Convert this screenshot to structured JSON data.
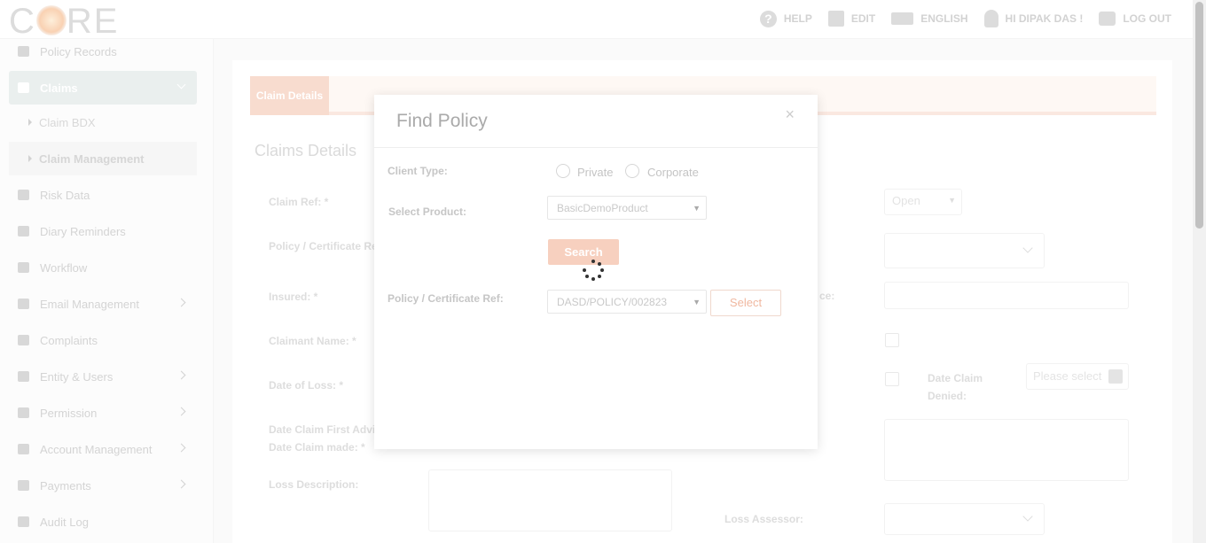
{
  "topbar": {
    "logo_text": "C RE",
    "nav": [
      {
        "label": "HELP",
        "icon": "help-icon"
      },
      {
        "label": "EDIT",
        "icon": "edit-icon"
      },
      {
        "label": "ENGLISH",
        "icon": "language-icon"
      },
      {
        "label": "HI DIPAK DAS !",
        "icon": "user-icon"
      },
      {
        "label": "LOG OUT",
        "icon": "logout-icon"
      }
    ]
  },
  "sidebar": {
    "items": [
      {
        "label": "Policy Records",
        "icon": "records-icon"
      },
      {
        "label": "Claims",
        "icon": "user-icon"
      },
      {
        "label": "Claim BDX"
      },
      {
        "label": "Claim Management"
      },
      {
        "label": "Risk Data",
        "icon": "scale-icon"
      },
      {
        "label": "Diary Reminders",
        "icon": "calendar-icon"
      },
      {
        "label": "Workflow",
        "icon": "sitemap-icon"
      },
      {
        "label": "Email Management",
        "icon": "at-icon"
      },
      {
        "label": "Complaints",
        "icon": "warning-icon"
      },
      {
        "label": "Entity & Users",
        "icon": "user-icon"
      },
      {
        "label": "Permission",
        "icon": "key-icon"
      },
      {
        "label": "Account Management",
        "icon": "card-icon"
      },
      {
        "label": "Payments",
        "icon": "card-icon"
      },
      {
        "label": "Audit Log",
        "icon": "chart-icon"
      }
    ]
  },
  "main": {
    "tab_label": "Claim Details",
    "section_title": "Claims Details",
    "labels": {
      "claim_ref": "Claim Ref: *",
      "policy_ref": "Policy / Certificate Re",
      "insured": "Insured: *",
      "claimant": "Claimant Name: *",
      "date_of_loss": "Date of Loss: *",
      "date_first_advice": "Date Claim First Advi",
      "date_claim_made": "Date Claim made: *",
      "loss_description": "Loss Description:",
      "ice": "ce:",
      "date_claim_denied": "Date Claim Denied:",
      "loss_assessor": "Loss Assessor:"
    },
    "status_value": "Open",
    "date_placeholder": "Please select"
  },
  "modal": {
    "title": "Find Policy",
    "close": "×",
    "client_type_label": "Client Type:",
    "radio_private": "Private",
    "radio_corporate": "Corporate",
    "select_product_label": "Select Product:",
    "product_value": "BasicDemoProduct",
    "search_button": "Search",
    "policy_ref_label": "Policy / Certificate Ref:",
    "policy_ref_value": "DASD/POLICY/002823",
    "select_button": "Select"
  }
}
